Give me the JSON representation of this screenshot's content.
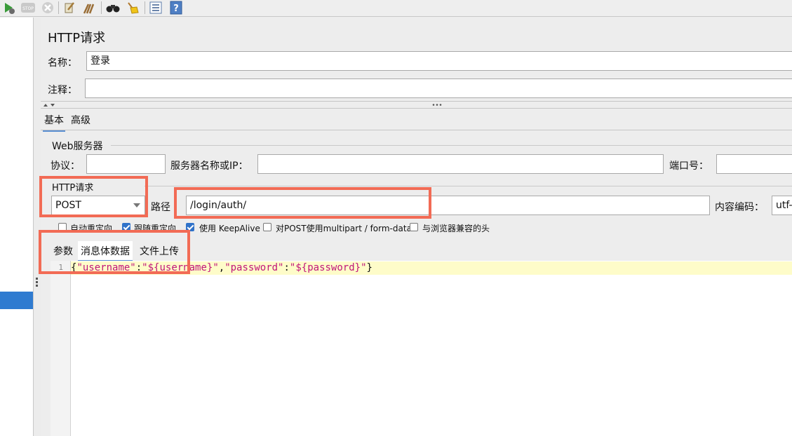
{
  "panel": {
    "title": "HTTP请求",
    "name_label": "名称：",
    "name_value": "登录",
    "comment_label": "注释：",
    "comment_value": ""
  },
  "tabs": {
    "basic": "基本",
    "advanced": "高级"
  },
  "web_server": {
    "group_title": "Web服务器",
    "protocol_label": "协议：",
    "protocol_value": "",
    "server_label": "服务器名称或IP：",
    "server_value": "",
    "port_label": "端口号：",
    "port_value": ""
  },
  "http_request": {
    "group_title": "HTTP请求",
    "method": "POST",
    "path_label": "路径",
    "path_value": "/login/auth/",
    "encoding_label": "内容编码：",
    "encoding_value": "utf-"
  },
  "options": [
    {
      "label": "自动重定向",
      "checked": false
    },
    {
      "label": "跟随重定向",
      "checked": true
    },
    {
      "label": "使用 KeepAlive",
      "checked": true
    },
    {
      "label": "对POST使用multipart / form-data",
      "checked": false
    },
    {
      "label": "与浏览器兼容的头",
      "checked": false
    }
  ],
  "body_tabs": {
    "params": "参数",
    "body_data": "消息体数据",
    "files_upload": "文件上传"
  },
  "editor": {
    "line_number": "1",
    "code": {
      "brace_open": "{",
      "k1": "\"username\"",
      "c1": ":",
      "v1": "\"${username}\"",
      "comma": ",",
      "k2": "\"password\"",
      "c2": ":",
      "v2": "\"${password}\"",
      "brace_close": "}"
    }
  },
  "colors": {
    "selection": "#2f7bd0",
    "highlight_box": "#f26b55",
    "string": "#c0157a",
    "current_line": "#fefcc9"
  },
  "toolbar_icons": [
    "run-no-pause-icon",
    "stop-icon",
    "shutdown-icon",
    "clear-icon",
    "clear-all-icon",
    "search-binoculars-icon",
    "reset-search-broom-icon",
    "function-helper-list-icon",
    "help-icon"
  ]
}
